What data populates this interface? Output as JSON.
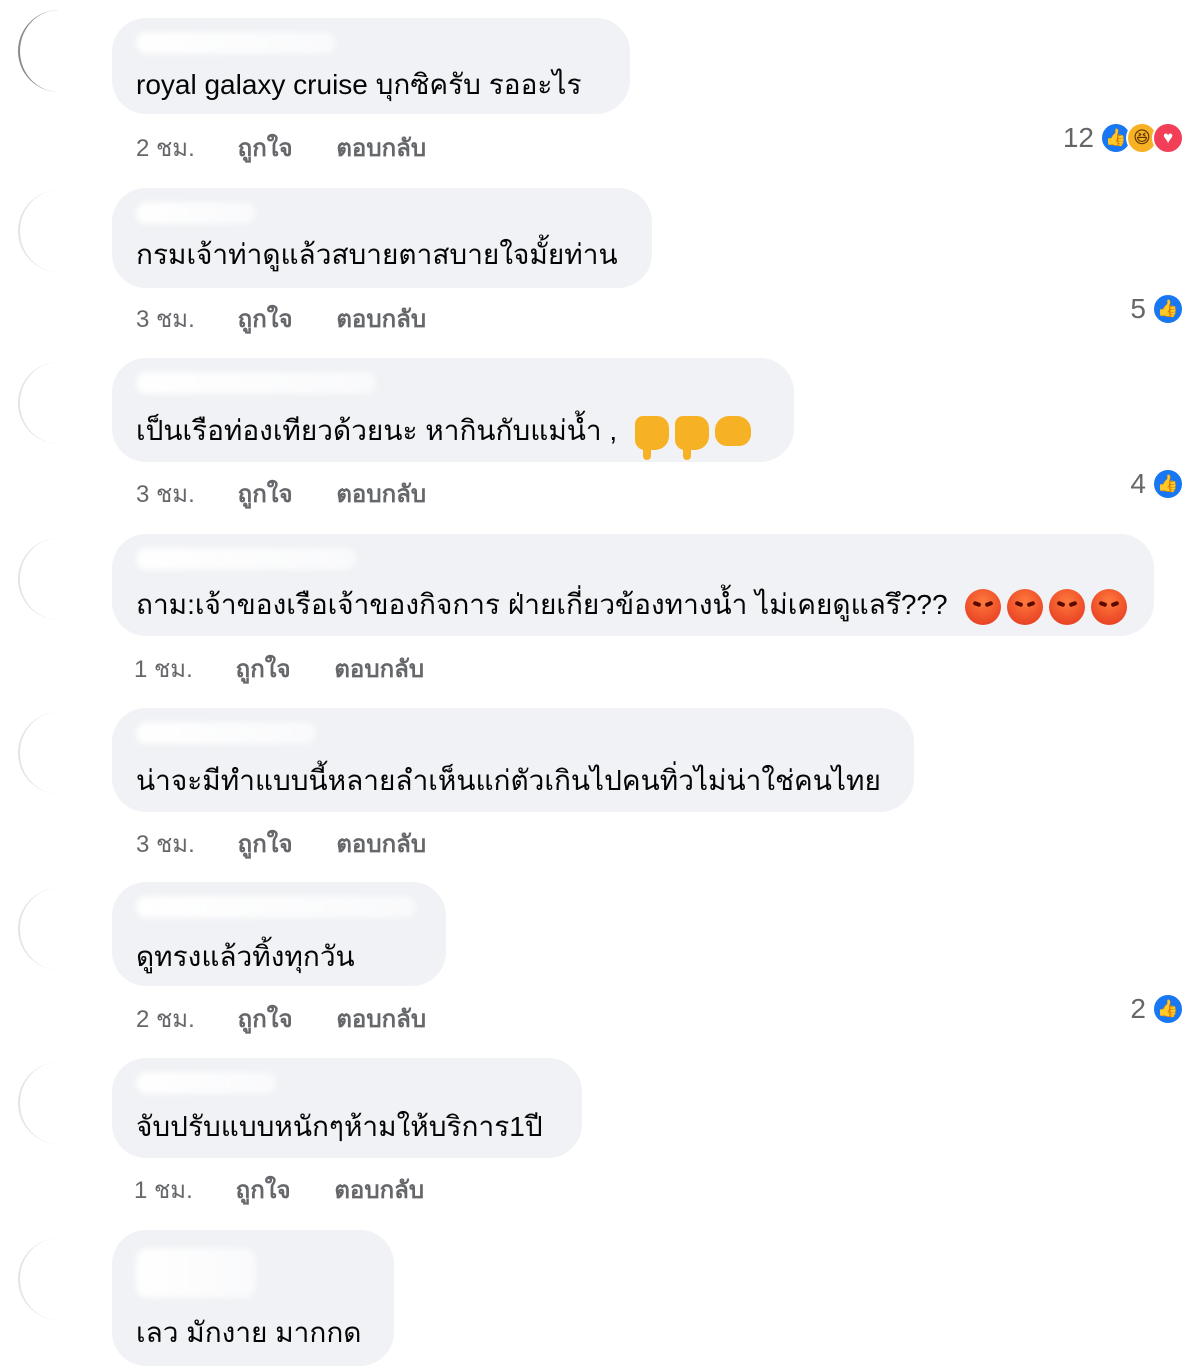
{
  "actions": {
    "like": "ถูกใจ",
    "reply": "ตอบกลับ"
  },
  "comments": [
    {
      "text": "royal galaxy cruise บุกซิครับ รออะไร",
      "time": "2 ชม.",
      "reaction_count": "12",
      "reactions": [
        "like-icon",
        "haha-icon",
        "love-icon"
      ]
    },
    {
      "text": "กรมเจ้าท่าดูแล้วสบายตาสบายใจมั้ยท่าน",
      "time": "3 ชม.",
      "reaction_count": "5",
      "reactions": [
        "like-icon"
      ]
    },
    {
      "text": "เป็นเรือท่องเทียวด้วยนะ  หากินกับแม่น้ำ  ,",
      "time": "3 ชม.",
      "reaction_count": "4",
      "reactions": [
        "like-icon"
      ],
      "emojis": [
        "thumbs-down-icon",
        "thumbs-down-icon",
        "fist-icon"
      ]
    },
    {
      "text": "ถาม:เจ้าของเรือเจ้าของกิจการ ฝ่ายเกี่ยวข้องทางน้ำ ไม่เคยดูแลรึ???",
      "time": "1 ชม.",
      "reaction_count": "",
      "emojis": [
        "angry-face-icon",
        "angry-face-icon",
        "angry-face-icon",
        "angry-face-icon"
      ]
    },
    {
      "text": "น่าจะมีทำแบบนี้หลายลำเห็นแก่ตัวเกินไปคนทิ่วไม่น่าใช่คนไทย",
      "time": "3 ชม.",
      "reaction_count": ""
    },
    {
      "text": "ดูทรงแล้วทิ้งทุกวัน",
      "time": "2 ชม.",
      "reaction_count": "2",
      "reactions": [
        "like-icon"
      ]
    },
    {
      "text": "จับปรับแบบหนักๆห้ามให้บริการ1ปี",
      "time": "1 ชม.",
      "reaction_count": ""
    },
    {
      "text": "เลว มักงาย มากกด",
      "time": "",
      "reaction_count": ""
    }
  ],
  "colors": {
    "bubble": "#f0f2f5",
    "meta": "#65676b",
    "like_blue": "#1877f2",
    "love_red": "#f33e58",
    "haha_yellow": "#f7b125"
  }
}
